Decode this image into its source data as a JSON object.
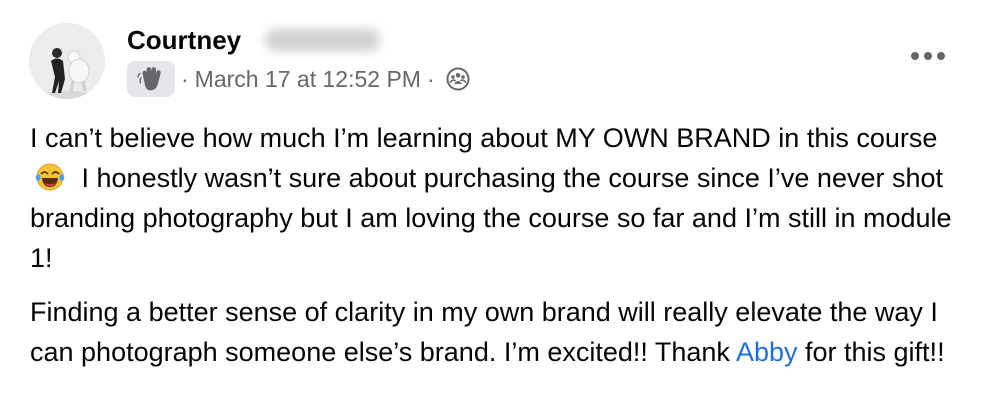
{
  "post": {
    "author_name": "Courtney",
    "audience_badge_icon": "waving-hand-icon",
    "separator": "·",
    "timestamp": "March 17 at 12:52 PM",
    "privacy_icon": "group-members-icon",
    "more_options_icon": "ellipsis-icon",
    "paragraph1": {
      "text_before_emoji": "I can’t believe how much I’m learning about MY OWN BRAND in this course",
      "emoji": "face-with-tears-of-joy",
      "text_after_emoji": "I honestly wasn’t sure about purchasing the course since I’ve never shot branding photography but I am loving the course so far and I’m still in module 1!"
    },
    "paragraph2": {
      "text": "Finding a better sense of clarity in my own brand will really elevate the way I can photograph someone else’s brand. I’m excited!! Thank",
      "mention": "Abby",
      "text_end": "for this gift!!"
    }
  },
  "colors": {
    "text": "#050505",
    "secondary_text": "#65676b",
    "mention_link": "#216fdb",
    "badge_background": "#e4e6eb"
  }
}
